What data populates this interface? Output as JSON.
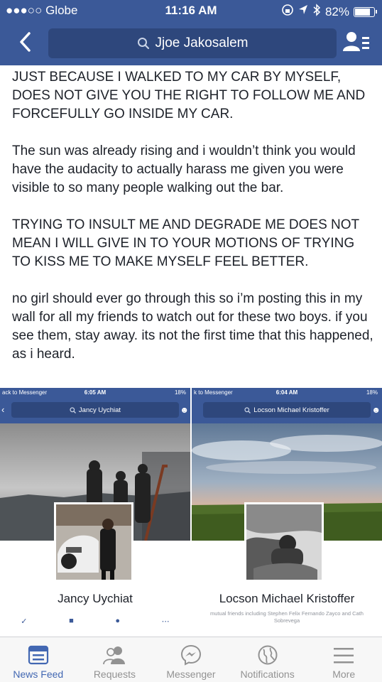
{
  "status_bar": {
    "carrier": "●●●○○ Globe",
    "time": "11:16 AM",
    "battery": "82%",
    "battery_level": 0.82
  },
  "nav": {
    "search_text": "Jjoe Jakosalem"
  },
  "post": {
    "paragraphs": [
      "JUST BECAUSE I WALKED TO MY CAR BY MYSELF, DOES NOT GIVE YOU THE RIGHT TO FOLLOW ME AND FORCEFULLY GO INSIDE MY CAR.",
      "The sun was already rising and i wouldn’t think you would have the audacity to actually harass me given you were visible to so many people walking out the bar.",
      "TRYING TO INSULT ME AND DEGRADE ME DOES NOT MEAN I WILL GIVE IN TO YOUR MOTIONS OF TRYING TO KISS ME TO MAKE MYSELF FEEL BETTER.",
      "no girl should ever go through this so i’m posting this in my wall for all my friends to watch out for these two boys. if you see them, stay away. its not the first time that this happened, as i heard."
    ]
  },
  "screenshots": [
    {
      "back_label": "ack to Messenger",
      "time": "6:05 AM",
      "battery": "18%",
      "search_text": "Jancy Uychiat",
      "name": "Jancy Uychiat"
    },
    {
      "back_label": "k to Messenger",
      "time": "6:04 AM",
      "battery": "18%",
      "search_text": "Locson Michael Kristoffer",
      "name": "Locson Michael Kristoffer",
      "mutual": "mutual friends including Stephen Felix Fernando Zayco and Cath\nSobrevega"
    }
  ],
  "tabs": [
    {
      "label": "News Feed",
      "icon": "news-feed-icon",
      "active": true
    },
    {
      "label": "Requests",
      "icon": "friend-requests-icon"
    },
    {
      "label": "Messenger",
      "icon": "messenger-icon"
    },
    {
      "label": "Notifications",
      "icon": "globe-icon"
    },
    {
      "label": "More",
      "icon": "menu-icon"
    }
  ],
  "colors": {
    "brand": "#3b5998",
    "tab_active": "#4267b2",
    "tab_inactive": "#929292"
  }
}
